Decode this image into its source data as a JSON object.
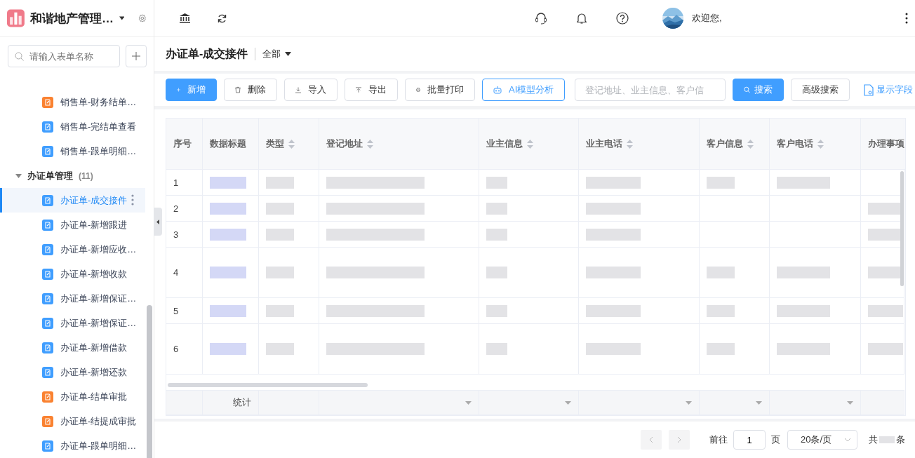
{
  "sidebar": {
    "app_title": "和谐地产管理…",
    "search": {
      "placeholder": "请输入表单名称"
    },
    "items": [
      {
        "label": "销售单-财务结单…",
        "color": "#fa8231",
        "selected": false
      },
      {
        "label": "销售单-完结单查看",
        "color": "#409eff",
        "selected": false
      },
      {
        "label": "销售单-跟单明细…",
        "color": "#409eff",
        "selected": false
      }
    ],
    "group": {
      "label": "办证单管理",
      "count": "(11)",
      "expanded": true,
      "children": [
        {
          "label": "办证单-成交接件",
          "color": "#409eff",
          "selected": true
        },
        {
          "label": "办证单-新增跟进",
          "color": "#409eff",
          "selected": false
        },
        {
          "label": "办证单-新增应收…",
          "color": "#409eff",
          "selected": false
        },
        {
          "label": "办证单-新增收款",
          "color": "#409eff",
          "selected": false
        },
        {
          "label": "办证单-新增保证…",
          "color": "#409eff",
          "selected": false
        },
        {
          "label": "办证单-新增保证…",
          "color": "#409eff",
          "selected": false
        },
        {
          "label": "办证单-新增借款",
          "color": "#409eff",
          "selected": false
        },
        {
          "label": "办证单-新增还款",
          "color": "#409eff",
          "selected": false
        },
        {
          "label": "办证单-结单审批",
          "color": "#fa8231",
          "selected": false
        },
        {
          "label": "办证单-结提成审批",
          "color": "#fa8231",
          "selected": false
        },
        {
          "label": "办证单-跟单明细…",
          "color": "#409eff",
          "selected": false
        }
      ]
    }
  },
  "topbar": {
    "greeting": "欢迎您,"
  },
  "page": {
    "title": "办证单-成交接件",
    "filter": "全部"
  },
  "toolbar": {
    "buttons": [
      {
        "label": "新增",
        "kind": "primary"
      },
      {
        "label": "删除",
        "kind": "delete"
      },
      {
        "label": "导入",
        "kind": "import"
      },
      {
        "label": "导出",
        "kind": "export"
      },
      {
        "label": "批量打印",
        "kind": "print"
      },
      {
        "label": "AI模型分析",
        "kind": "ai"
      }
    ],
    "search": {
      "placeholder": "登记地址、业主信息、客户信"
    },
    "search_button": "搜索",
    "advanced": "高级搜索",
    "fields_link": "显示字段"
  },
  "table": {
    "columns": [
      {
        "label": "序号",
        "sortable": false
      },
      {
        "label": "数据标题",
        "sortable": false
      },
      {
        "label": "类型",
        "sortable": true
      },
      {
        "label": "登记地址",
        "sortable": true
      },
      {
        "label": "业主信息",
        "sortable": true
      },
      {
        "label": "业主电话",
        "sortable": true
      },
      {
        "label": "客户信息",
        "sortable": true
      },
      {
        "label": "客户电话",
        "sortable": true
      },
      {
        "label": "办理事项",
        "sortable": false
      }
    ],
    "rows": [
      {
        "index": "1",
        "tall": false,
        "masked": [
          true,
          true,
          true,
          true,
          true,
          true,
          true,
          false
        ]
      },
      {
        "index": "2",
        "tall": false,
        "masked": [
          true,
          true,
          true,
          true,
          true,
          false,
          false,
          true
        ]
      },
      {
        "index": "3",
        "tall": false,
        "masked": [
          true,
          true,
          true,
          true,
          true,
          false,
          false,
          true
        ]
      },
      {
        "index": "4",
        "tall": true,
        "masked": [
          true,
          true,
          true,
          true,
          true,
          true,
          true,
          true
        ]
      },
      {
        "index": "5",
        "tall": false,
        "masked": [
          true,
          true,
          true,
          true,
          true,
          true,
          true,
          true
        ]
      },
      {
        "index": "6",
        "tall": true,
        "masked": [
          true,
          true,
          true,
          true,
          true,
          true,
          true,
          true
        ]
      }
    ],
    "summary": {
      "label": "统计"
    }
  },
  "pagination": {
    "goto": "前往",
    "page": "1",
    "page_unit": "页",
    "page_size": "20条/页",
    "total_prefix": "共",
    "total_suffix": "条"
  }
}
